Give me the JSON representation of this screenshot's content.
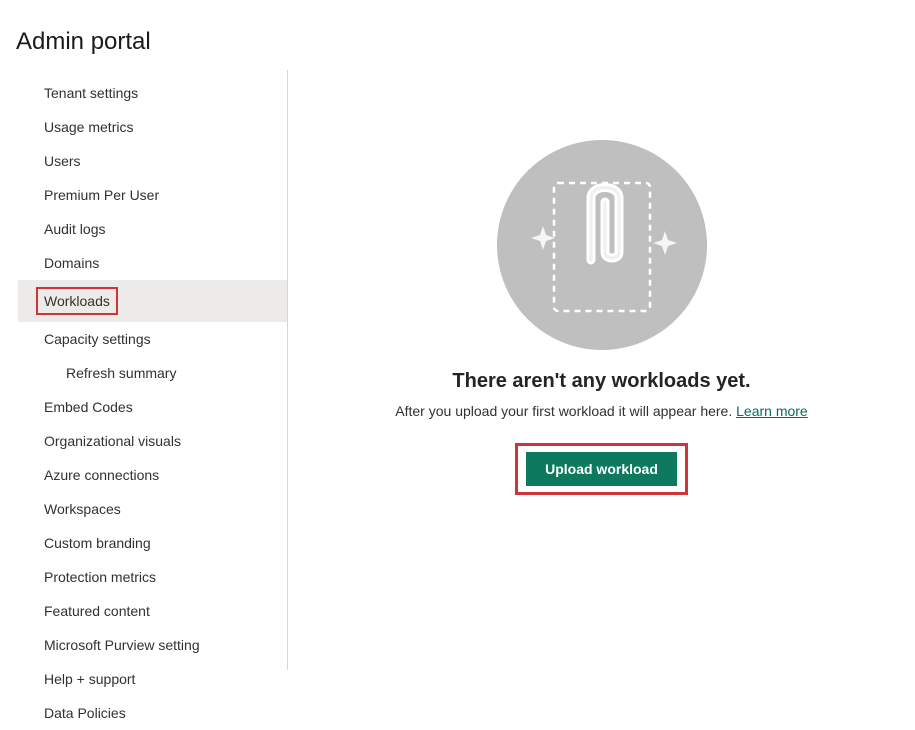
{
  "header": {
    "title": "Admin portal"
  },
  "sidebar": {
    "items": [
      {
        "label": "Tenant settings"
      },
      {
        "label": "Usage metrics"
      },
      {
        "label": "Users"
      },
      {
        "label": "Premium Per User"
      },
      {
        "label": "Audit logs"
      },
      {
        "label": "Domains"
      },
      {
        "label": "Workloads"
      },
      {
        "label": "Capacity settings"
      },
      {
        "label": "Refresh summary"
      },
      {
        "label": "Embed Codes"
      },
      {
        "label": "Organizational visuals"
      },
      {
        "label": "Azure connections"
      },
      {
        "label": "Workspaces"
      },
      {
        "label": "Custom branding"
      },
      {
        "label": "Protection metrics"
      },
      {
        "label": "Featured content"
      },
      {
        "label": "Microsoft Purview setting"
      },
      {
        "label": "Help + support"
      },
      {
        "label": "Data Policies"
      }
    ]
  },
  "main": {
    "empty_title": "There aren't any workloads yet.",
    "empty_subtitle": "After you upload your first workload it will appear here. ",
    "learn_more": "Learn more",
    "upload_button": "Upload workload"
  },
  "colors": {
    "accent": "#0d7a5f",
    "highlight_border": "#d13438",
    "illustration_bg": "#bfbfbf"
  }
}
